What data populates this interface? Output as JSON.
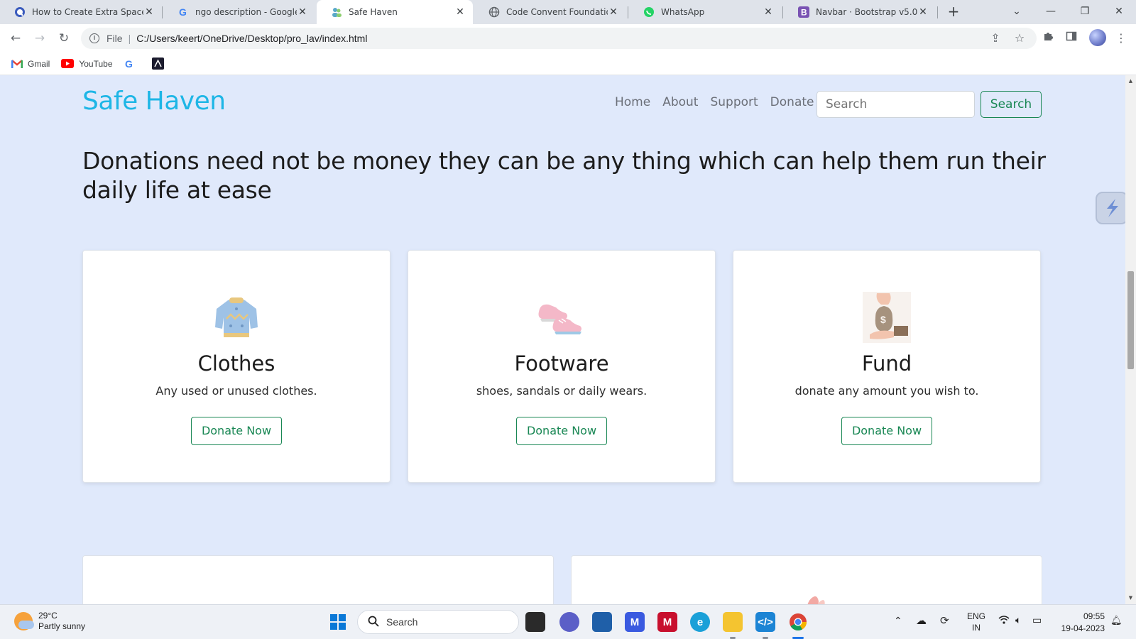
{
  "browser": {
    "tabs": [
      {
        "title": "How to Create Extra Space",
        "icon": "circle-q-icon",
        "active": false
      },
      {
        "title": "ngo description - Google Se",
        "icon": "google-icon",
        "active": false
      },
      {
        "title": "Safe Haven",
        "icon": "people-icon",
        "active": true
      },
      {
        "title": "Code Convent Foundation",
        "icon": "globe-icon",
        "active": false
      },
      {
        "title": "WhatsApp",
        "icon": "whatsapp-icon",
        "active": false
      },
      {
        "title": "Navbar · Bootstrap v5.0",
        "icon": "bootstrap-icon",
        "active": false
      }
    ],
    "address": {
      "scheme": "File",
      "url": "C:/Users/keert/OneDrive/Desktop/pro_lav/index.html"
    },
    "bookmarks": [
      {
        "label": "Gmail",
        "icon": "gmail-icon"
      },
      {
        "label": "YouTube",
        "icon": "youtube-icon"
      },
      {
        "label": "",
        "icon": "google-icon"
      },
      {
        "label": "",
        "icon": "app-icon"
      }
    ]
  },
  "site": {
    "brand": "Safe Haven",
    "nav": [
      "Home",
      "About",
      "Support",
      "Donate"
    ],
    "search": {
      "placeholder": "Search",
      "button": "Search"
    },
    "headline": "Donations need not be money they can be any thing which can help them run their daily life at ease",
    "cards": [
      {
        "title": "Clothes",
        "text": "Any used or unused clothes.",
        "button": "Donate Now",
        "icon": "sweater-icon"
      },
      {
        "title": "Footware",
        "text": "shoes, sandals or daily wears.",
        "button": "Donate Now",
        "icon": "sneakers-icon"
      },
      {
        "title": "Fund",
        "text": "donate any amount you wish to.",
        "button": "Donate Now",
        "icon": "money-bag-icon"
      }
    ]
  },
  "taskbar": {
    "weather": {
      "temp": "29°C",
      "desc": "Partly sunny"
    },
    "search": "Search",
    "lang": {
      "line1": "ENG",
      "line2": "IN"
    },
    "clock": {
      "time": "09:55",
      "date": "19-04-2023"
    }
  },
  "colors": {
    "brand": "#1eb6e6",
    "accent_green": "#198754",
    "page_bg": "#e0e9fb"
  }
}
